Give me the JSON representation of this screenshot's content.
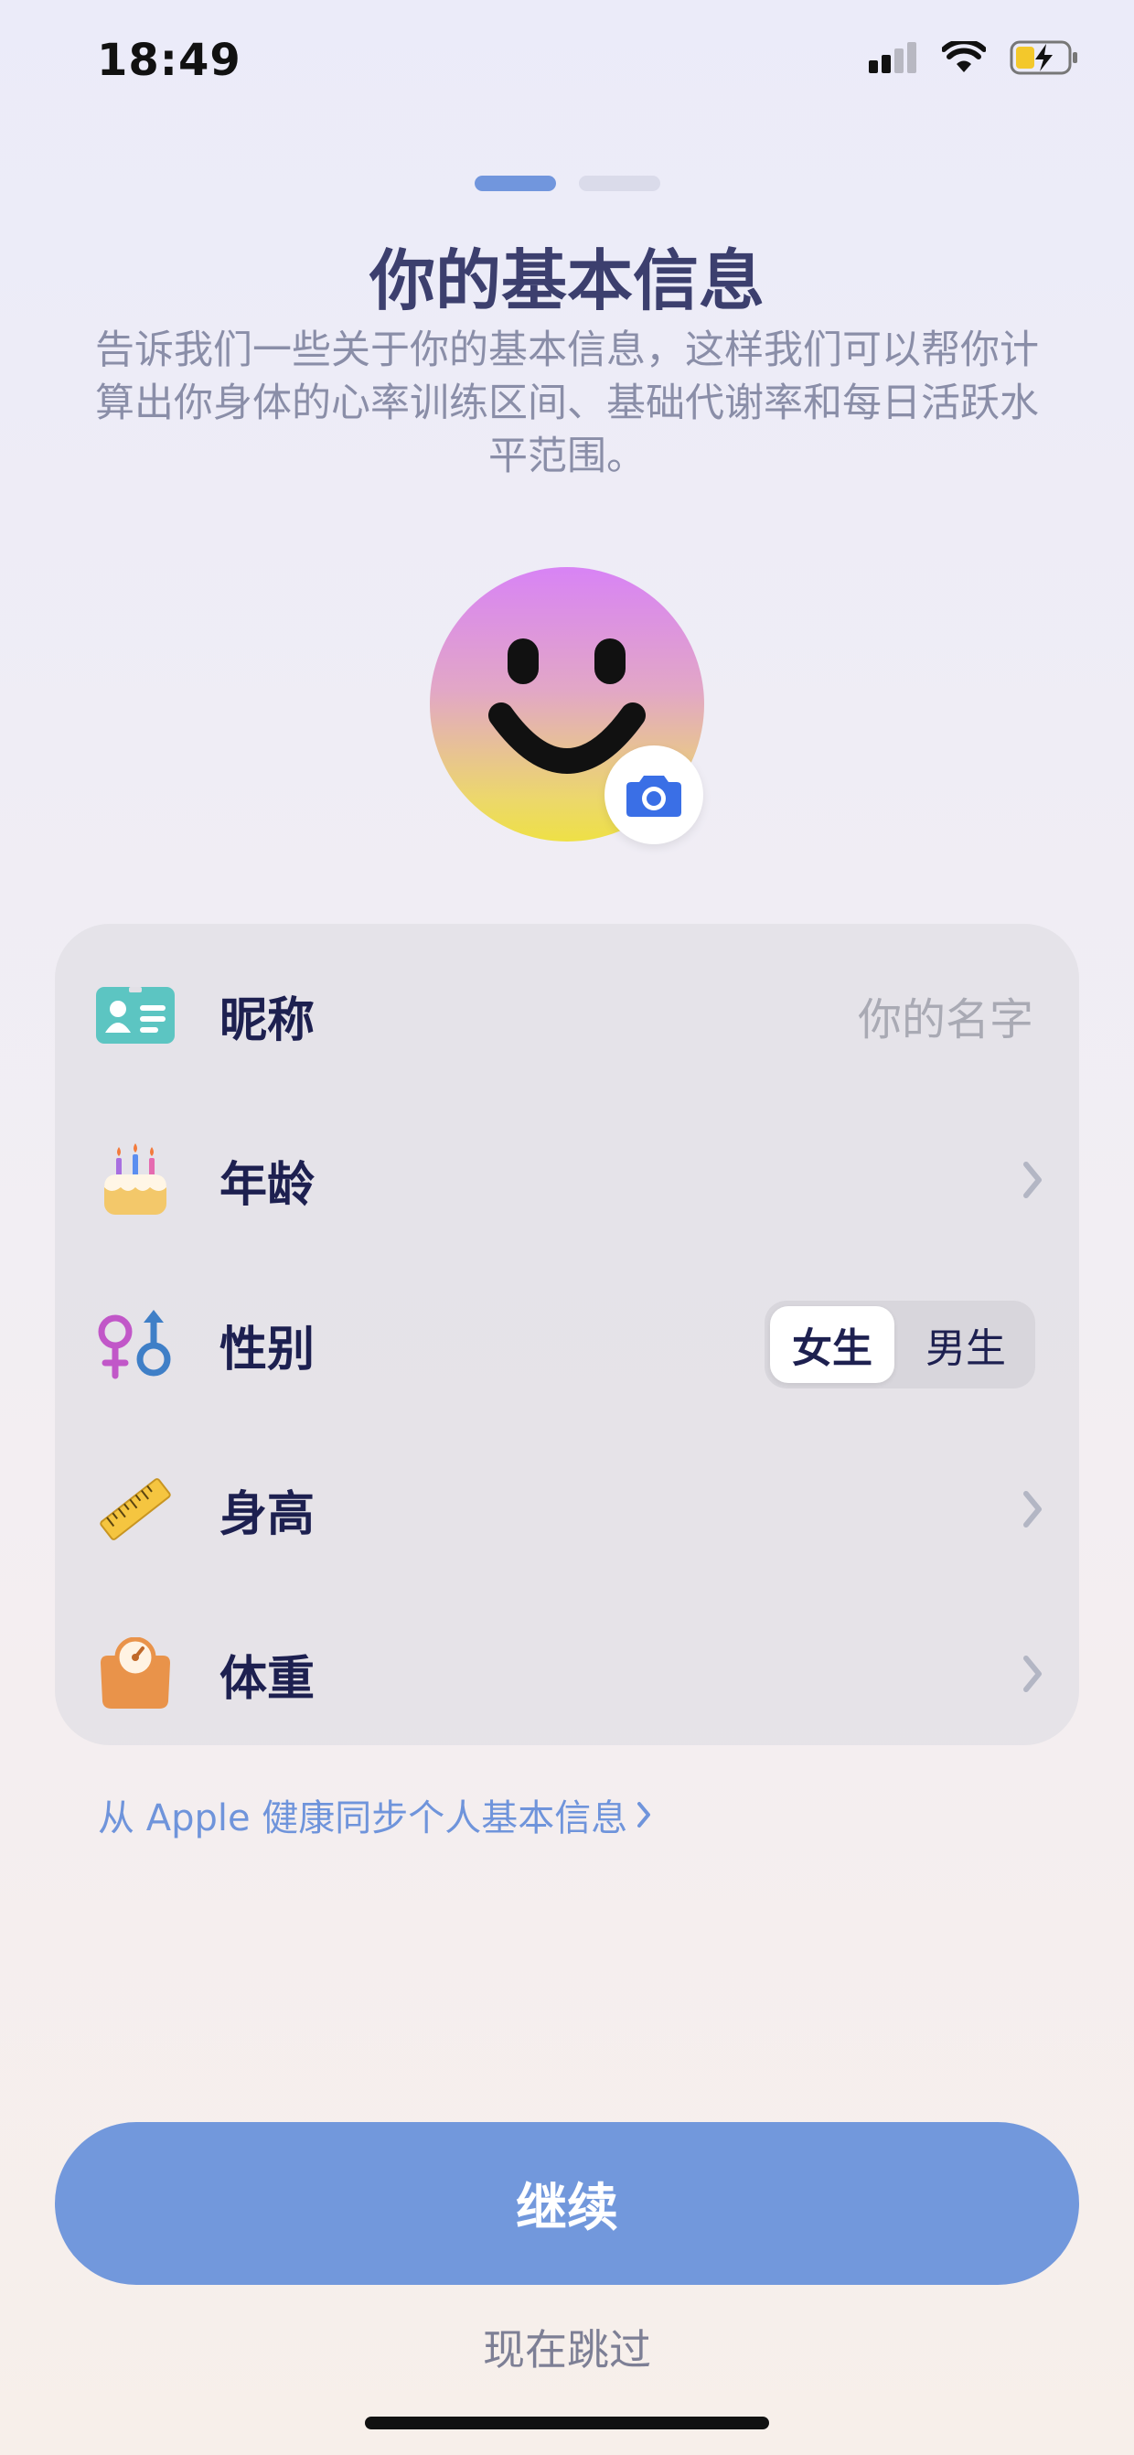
{
  "status_bar": {
    "time": "18:49"
  },
  "pager": {
    "total": 2,
    "current": 1
  },
  "header": {
    "title": "你的基本信息",
    "description": "告诉我们一些关于你的基本信息，这样我们可以帮你计算出你身体的心率训练区间、基础代谢率和每日活跃水平范围。"
  },
  "avatar": {
    "icon": "smiley-face-icon",
    "edit_icon": "camera-icon"
  },
  "form": {
    "nickname": {
      "label": "昵称",
      "placeholder": "你的名字",
      "icon": "id-card-icon"
    },
    "age": {
      "label": "年龄",
      "icon": "birthday-cake-icon"
    },
    "gender": {
      "label": "性别",
      "icon": "gender-symbols-icon",
      "options": [
        "女生",
        "男生"
      ],
      "selected": "女生"
    },
    "height": {
      "label": "身高",
      "icon": "ruler-icon"
    },
    "weight": {
      "label": "体重",
      "icon": "scale-icon"
    }
  },
  "sync_link": {
    "label": "从 Apple 健康同步个人基本信息"
  },
  "actions": {
    "continue_label": "继续",
    "skip_label": "现在跳过"
  },
  "colors": {
    "accent": "#7298dc",
    "title": "#3c3f6e",
    "label": "#1d2050"
  }
}
